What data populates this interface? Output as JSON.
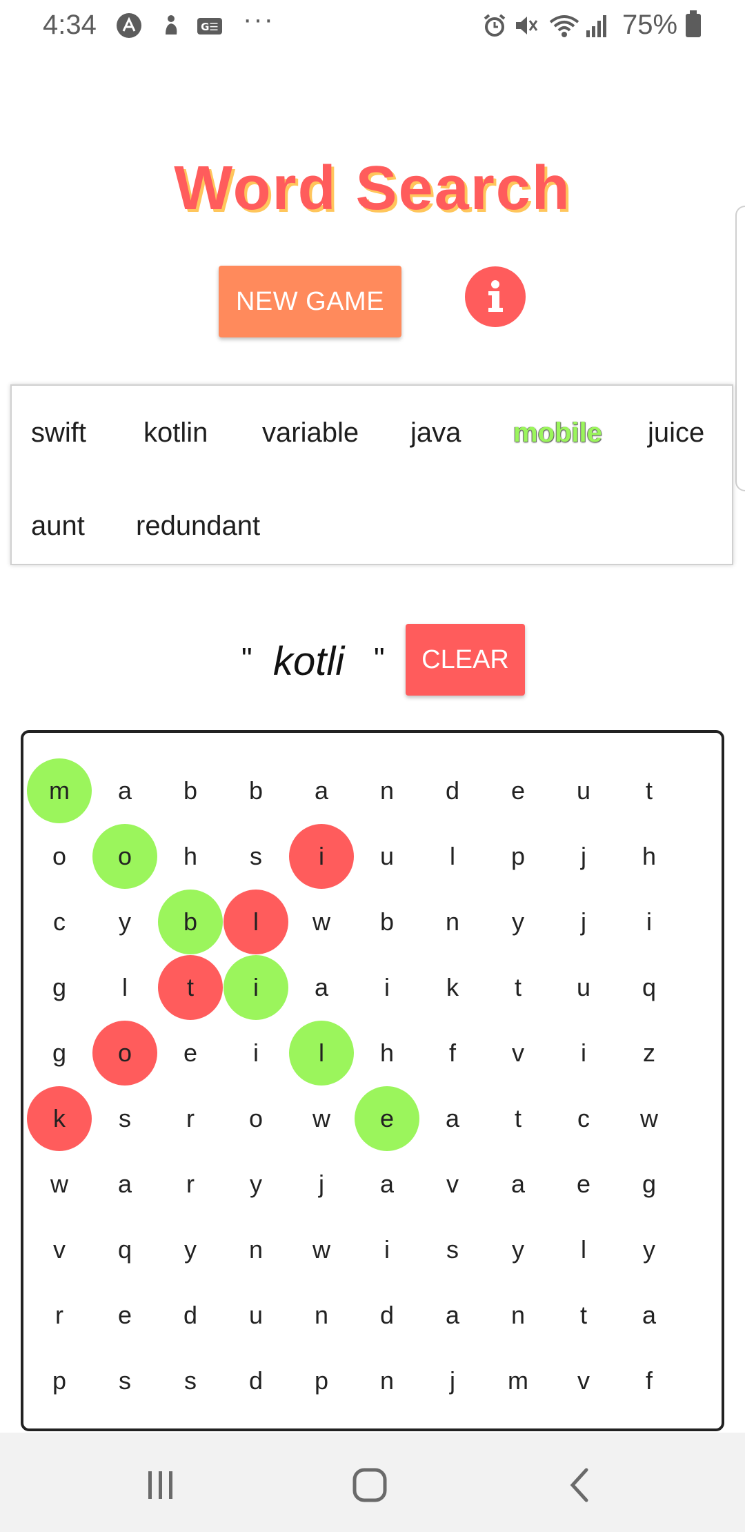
{
  "status_bar": {
    "time": "4:34",
    "dots": "···",
    "battery_percent": "75%",
    "icons": [
      "a-badge-icon",
      "person-icon",
      "ge-icon",
      "alarm-icon",
      "mute-icon",
      "wifi-icon",
      "signal-icon",
      "battery-icon"
    ]
  },
  "header": {
    "title": "Word Search",
    "new_game_label": "NEW GAME",
    "info_icon": "info-icon"
  },
  "word_list": [
    {
      "text": "swift",
      "found": false
    },
    {
      "text": "kotlin",
      "found": false
    },
    {
      "text": "variable",
      "found": false
    },
    {
      "text": "java",
      "found": false
    },
    {
      "text": "mobile",
      "found": true
    },
    {
      "text": "juice",
      "found": false
    },
    {
      "text": "aunt",
      "found": false
    },
    {
      "text": "redundant",
      "found": false
    }
  ],
  "selection": {
    "open_quote": "\"",
    "current": "kotli",
    "close_quote": "\"",
    "clear_label": "CLEAR"
  },
  "grid": {
    "rows": [
      [
        "m",
        "a",
        "b",
        "b",
        "a",
        "n",
        "d",
        "e",
        "u",
        "t"
      ],
      [
        "o",
        "o",
        "h",
        "s",
        "i",
        "u",
        "l",
        "p",
        "j",
        "h"
      ],
      [
        "c",
        "y",
        "b",
        "l",
        "w",
        "b",
        "n",
        "y",
        "j",
        "i"
      ],
      [
        "g",
        "l",
        "t",
        "i",
        "a",
        "i",
        "k",
        "t",
        "u",
        "q"
      ],
      [
        "g",
        "o",
        "e",
        "i",
        "l",
        "h",
        "f",
        "v",
        "i",
        "z"
      ],
      [
        "k",
        "s",
        "r",
        "o",
        "w",
        "e",
        "a",
        "t",
        "c",
        "w"
      ],
      [
        "w",
        "a",
        "r",
        "y",
        "j",
        "a",
        "v",
        "a",
        "e",
        "g"
      ],
      [
        "v",
        "q",
        "y",
        "n",
        "w",
        "i",
        "s",
        "y",
        "l",
        "y"
      ],
      [
        "r",
        "e",
        "d",
        "u",
        "n",
        "d",
        "a",
        "n",
        "t",
        "a"
      ],
      [
        "p",
        "s",
        "s",
        "d",
        "p",
        "n",
        "j",
        "m",
        "v",
        "f"
      ]
    ],
    "found_cells": [
      [
        0,
        0
      ],
      [
        1,
        1
      ],
      [
        2,
        2
      ],
      [
        3,
        3
      ],
      [
        4,
        4
      ],
      [
        5,
        5
      ]
    ],
    "selected_cells": [
      [
        1,
        4
      ],
      [
        2,
        3
      ],
      [
        3,
        2
      ],
      [
        4,
        1
      ],
      [
        5,
        0
      ]
    ],
    "colors": {
      "found": "#9bf55c",
      "selected": "#ff5c5c"
    }
  },
  "nav_bar": {
    "icons": [
      "recent-apps-icon",
      "home-icon",
      "back-icon"
    ]
  },
  "colors": {
    "title": "#ff5c5c",
    "title_shadow": "#ffc65c",
    "new_game": "#ff8a5c",
    "clear": "#ff5c5c",
    "info": "#ff5c5c"
  }
}
